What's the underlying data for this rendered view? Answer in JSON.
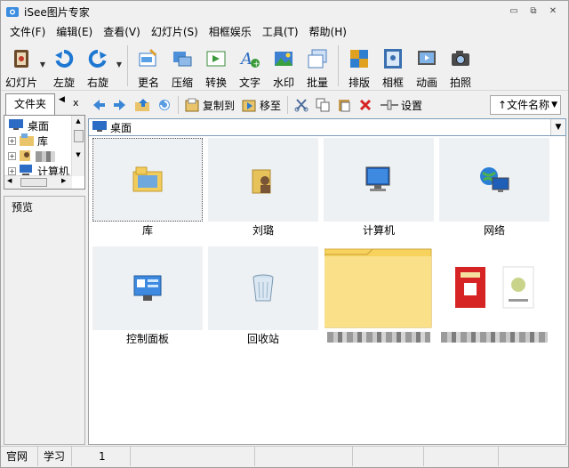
{
  "window": {
    "title": "iSee图片专家",
    "minimize": "▭",
    "restore": "⧉",
    "close": "✕"
  },
  "menu": [
    "文件(F)",
    "编辑(E)",
    "查看(V)",
    "幻灯片(S)",
    "相框娱乐",
    "工具(T)",
    "帮助(H)"
  ],
  "toolbar": {
    "slideshow": "幻灯片",
    "rotate_left": "左旋",
    "rotate_right": "右旋",
    "rename": "更名",
    "compress": "压缩",
    "convert": "转换",
    "text": "文字",
    "watermark": "水印",
    "batch": "批量",
    "layout": "排版",
    "frame": "相框",
    "animation": "动画",
    "capture": "拍照"
  },
  "left_panel": {
    "tab_label": "文件夹",
    "tree": [
      "桌面",
      "库",
      "",
      "计算机"
    ],
    "preview_label": "预览"
  },
  "toolbar2": {
    "copy_to": "复制到",
    "move_to": "移至",
    "settings": "设置",
    "sort": "↑文件名称"
  },
  "address": {
    "path": "桌面"
  },
  "items": [
    {
      "label": "库"
    },
    {
      "label": "刘璐"
    },
    {
      "label": "计算机"
    },
    {
      "label": "网络"
    },
    {
      "label": "控制面板"
    },
    {
      "label": "回收站"
    }
  ],
  "statusbar": {
    "site": "官网",
    "learn": "学习",
    "count": "1"
  },
  "colors": {
    "accent_blue": "#1e78d2",
    "folder_yellow": "#f7d25c",
    "red": "#d62424"
  }
}
